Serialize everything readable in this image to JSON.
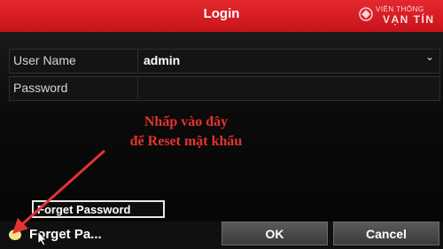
{
  "window": {
    "title": "Login"
  },
  "brand": {
    "line1": "VIỄN THÔNG",
    "line2": "VẠN TÍN"
  },
  "form": {
    "user_label": "User Name",
    "user_value": "admin",
    "pass_label": "Password",
    "pass_value": ""
  },
  "annotation": {
    "line1": "Nhấp vào đây",
    "line2": "để Reset mật khẩu",
    "color": "#e53232"
  },
  "buttons": {
    "forget_password": "Forget Password",
    "forget_short": "Forget Pa...",
    "ok": "OK",
    "cancel": "Cancel"
  },
  "colors": {
    "titlebar": "#d41c22",
    "accent": "#e53232"
  }
}
